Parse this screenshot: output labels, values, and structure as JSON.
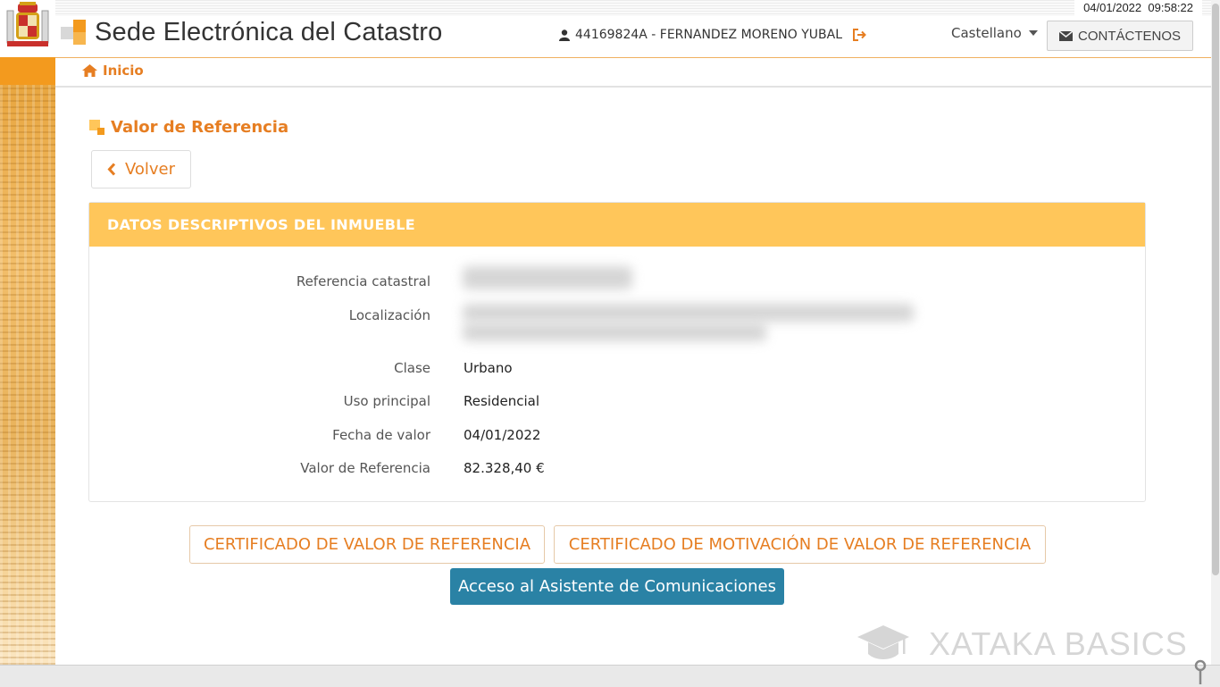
{
  "datetime": {
    "date": "04/01/2022",
    "time": "09:58:22"
  },
  "header": {
    "site_title": "Sede Electrónica del Catastro",
    "user": "44169824A - FERNANDEZ MORENO YUBAL",
    "language": "Castellano",
    "contact_label": "CONTÁCTENOS"
  },
  "nav": {
    "home_label": "Inicio"
  },
  "page": {
    "title": "Valor de Referencia",
    "back_label": "Volver",
    "panel_title": "DATOS DESCRIPTIVOS DEL INMUEBLE",
    "fields": [
      {
        "label": "Referencia catastral",
        "value": ""
      },
      {
        "label": "Localización",
        "value": ""
      },
      {
        "label": "Clase",
        "value": "Urbano"
      },
      {
        "label": "Uso principal",
        "value": "Residencial"
      },
      {
        "label": "Fecha de valor",
        "value": "04/01/2022"
      },
      {
        "label": "Valor de Referencia",
        "value": "82.328,40 €"
      }
    ],
    "buttons": {
      "cert_valor": "CERTIFICADO DE VALOR DE REFERENCIA",
      "cert_motivacion": "CERTIFICADO DE MOTIVACIÓN DE VALOR DE REFERENCIA",
      "asistente": "Acceso al Asistente de Comunicaciones"
    }
  },
  "watermark": "XATAKA BASICS",
  "colors": {
    "accent": "#e67e22",
    "panel_header": "#ffc65a",
    "primary_button": "#2a82a5",
    "left_bar": "#f39a1e"
  },
  "icons": [
    "user-icon",
    "logout-icon",
    "caret-down-icon",
    "envelope-icon",
    "home-icon",
    "square-icon",
    "chevron-left-icon",
    "mortarboard-icon",
    "pin-icon"
  ]
}
